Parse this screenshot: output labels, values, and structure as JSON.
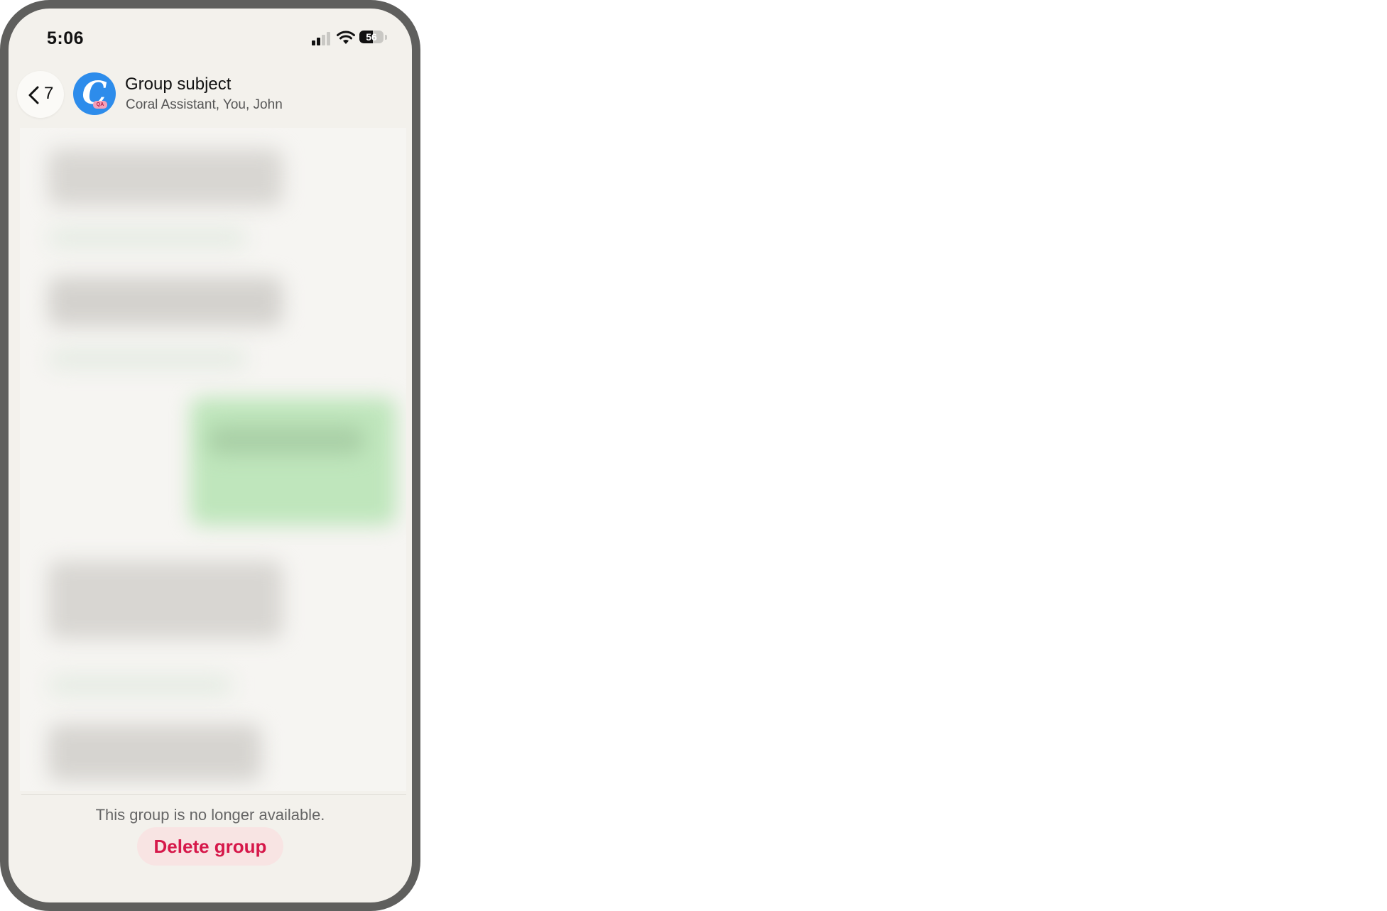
{
  "status_bar": {
    "time": "5:06",
    "battery_level": "56",
    "battery_fraction": 0.56,
    "icons": [
      "signal-icon",
      "wifi-icon",
      "battery-icon"
    ]
  },
  "header": {
    "back_count": "7",
    "title": "Group subject",
    "subtitle": "Coral Assistant, You, John",
    "avatar_letter": "C",
    "avatar_badge": "QA",
    "avatar_color": "#2d8ceb"
  },
  "footer": {
    "notice": "This group is no longer available.",
    "delete_label": "Delete group",
    "delete_color": "#d6184a"
  }
}
